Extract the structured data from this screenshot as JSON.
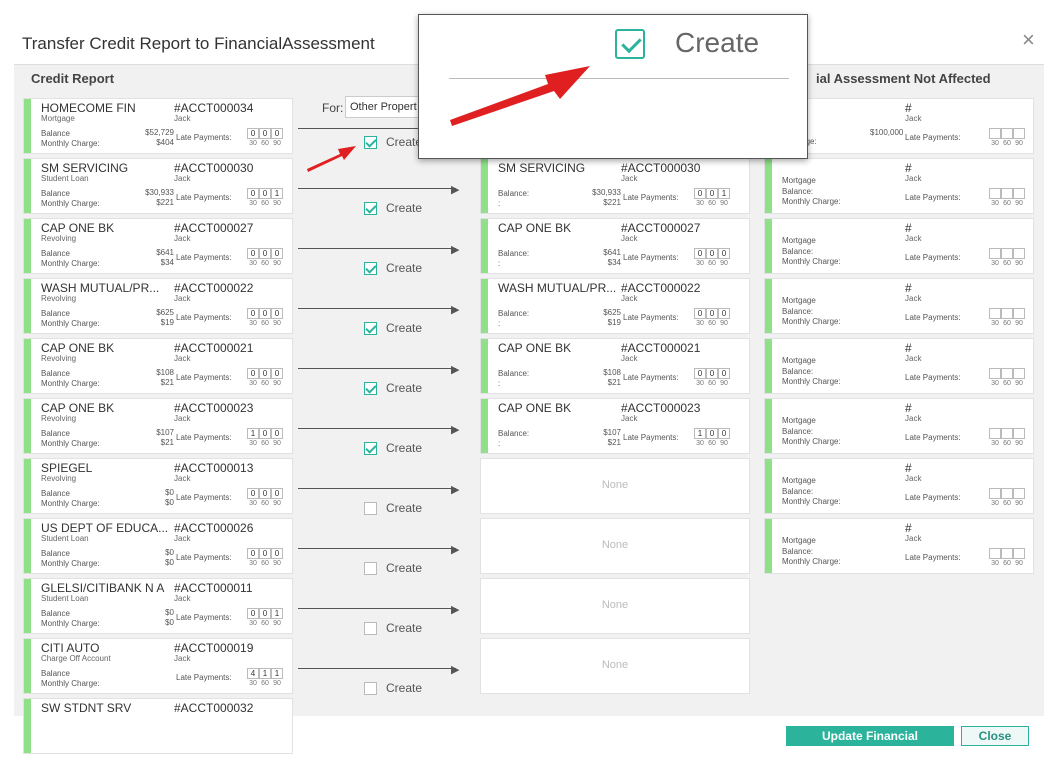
{
  "dialog": {
    "title": "Transfer Credit Report to FinancialAssessment",
    "close_icon": "×"
  },
  "columns": {
    "credit_report": "Credit Report",
    "not_affected": "ial Assessment Not Affected"
  },
  "for": {
    "label": "For:",
    "value": "Other Propert"
  },
  "zoom": {
    "label": "Create"
  },
  "labels": {
    "balance": "Balance",
    "balance_colon": "Balance:",
    "monthly_charge": "Monthly Charge:",
    "late_payments": "Late Payments:",
    "create": "Create",
    "none": "None",
    "mortgage": "Mortgage",
    "hash": "#",
    "dot": ":",
    "lp_30": "30",
    "lp_60": "60",
    "lp_90": "90"
  },
  "credit_items": [
    {
      "name": "HOMECOME FIN",
      "acct": "#ACCT000034",
      "type": "Mortgage",
      "owner": "Jack",
      "balance": "$52,729",
      "monthly": "$404",
      "lp": [
        "0",
        "0",
        "0"
      ]
    },
    {
      "name": "SM SERVICING",
      "acct": "#ACCT000030",
      "type": "Student Loan",
      "owner": "Jack",
      "balance": "$30,933",
      "monthly": "$221",
      "lp": [
        "0",
        "0",
        "1"
      ]
    },
    {
      "name": "CAP ONE BK",
      "acct": "#ACCT000027",
      "type": "Revolving",
      "owner": "Jack",
      "balance": "$641",
      "monthly": "$34",
      "lp": [
        "0",
        "0",
        "0"
      ]
    },
    {
      "name": "WASH MUTUAL/PR...",
      "acct": "#ACCT000022",
      "type": "Revolving",
      "owner": "Jack",
      "balance": "$625",
      "monthly": "$19",
      "lp": [
        "0",
        "0",
        "0"
      ]
    },
    {
      "name": "CAP ONE BK",
      "acct": "#ACCT000021",
      "type": "Revolving",
      "owner": "Jack",
      "balance": "$108",
      "monthly": "$21",
      "lp": [
        "0",
        "0",
        "0"
      ]
    },
    {
      "name": "CAP ONE BK",
      "acct": "#ACCT000023",
      "type": "Revolving",
      "owner": "Jack",
      "balance": "$107",
      "monthly": "$21",
      "lp": [
        "1",
        "0",
        "0"
      ]
    },
    {
      "name": "SPIEGEL",
      "acct": "#ACCT000013",
      "type": "Revolving",
      "owner": "Jack",
      "balance": "$0",
      "monthly": "$0",
      "lp": [
        "0",
        "0",
        "0"
      ]
    },
    {
      "name": "US DEPT OF EDUCA...",
      "acct": "#ACCT000026",
      "type": "Student Loan",
      "owner": "Jack",
      "balance": "$0",
      "monthly": "$0",
      "lp": [
        "0",
        "0",
        "0"
      ]
    },
    {
      "name": "GLELSI/CITIBANK N A",
      "acct": "#ACCT000011",
      "type": "Student Loan",
      "owner": "Jack",
      "balance": "$0",
      "monthly": "$0",
      "lp": [
        "0",
        "0",
        "1"
      ]
    },
    {
      "name": "CITI AUTO",
      "acct": "#ACCT000019",
      "type": "Charge Off Account",
      "owner": "Jack",
      "balance": "",
      "monthly": "",
      "lp": [
        "4",
        "1",
        "1"
      ]
    },
    {
      "name": "SW STDNT SRV",
      "acct": "#ACCT000032",
      "type": "",
      "owner": "",
      "balance": "",
      "monthly": "",
      "lp": []
    }
  ],
  "create_checks": [
    true,
    true,
    true,
    true,
    true,
    true,
    false,
    false,
    false,
    false
  ],
  "fa_top": {
    "hash": "#",
    "owner": "Jack",
    "mortgage": "ge",
    "balance_amt": "$100,000",
    "monthly": "y Charge:"
  },
  "fa_count": 8,
  "buttons": {
    "update": "Update Financial Assessment",
    "close": "Close"
  },
  "colors": {
    "accent": "#2bb39c",
    "bar": "#90e08a",
    "arrow": "#e02020"
  }
}
